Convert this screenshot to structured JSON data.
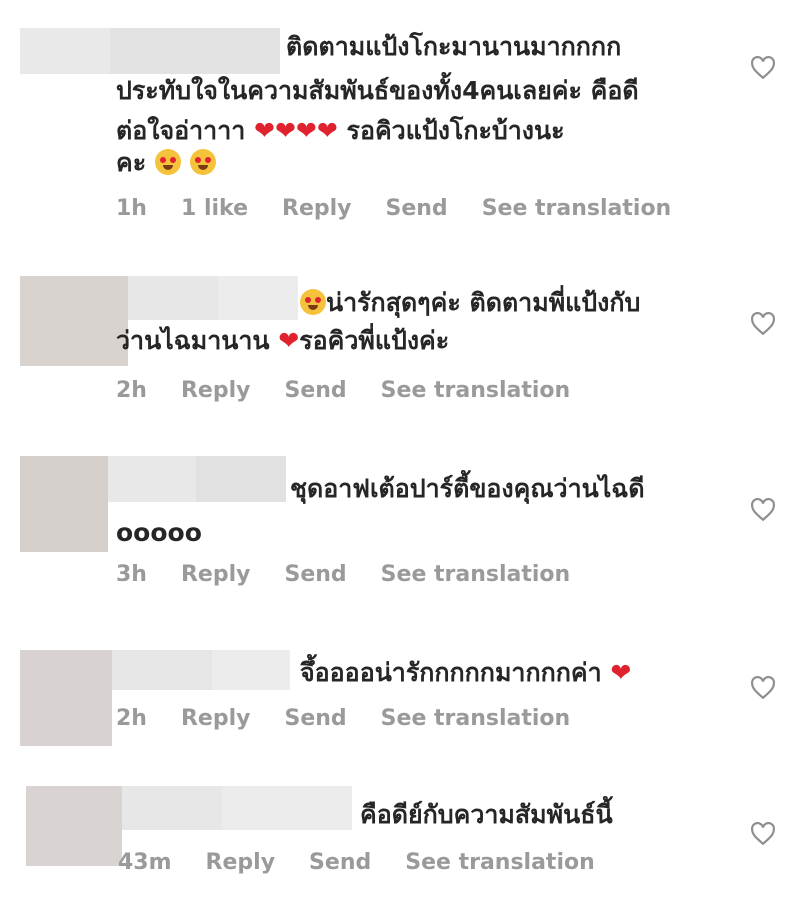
{
  "comments": [
    {
      "lines": [
        "ติดตามแป้งโกะมานานมากกกก",
        "ประทับใจในความสัมพันธ์ของทั้ง4คนเลยค่ะ คือดี",
        "ต่อใจอ่าาาา",
        "รอคิวแป้งโกะบ้างนะ",
        "คะ"
      ],
      "time": "1h",
      "likes": "1 like",
      "reply": "Reply",
      "send": "Send",
      "translate": "See translation"
    },
    {
      "lines": [
        "น่ารักสุดๆค่ะ ติดตามพี่แป้งกับ",
        "ว่านไฉมานาน",
        "รอคิวพี่แป้งค่ะ"
      ],
      "time": "2h",
      "reply": "Reply",
      "send": "Send",
      "translate": "See translation"
    },
    {
      "lines": [
        "ชุดอาฟเต้อปาร์ตี้ของคุณว่านไฉดี",
        "ooooo"
      ],
      "time": "3h",
      "reply": "Reply",
      "send": "Send",
      "translate": "See translation"
    },
    {
      "lines": [
        "จึ้ออออน่ารักกกกกมากกกค่า"
      ],
      "time": "2h",
      "reply": "Reply",
      "send": "Send",
      "translate": "See translation"
    },
    {
      "lines": [
        "คือดีย์กับความสัมพันธ์นี้"
      ],
      "time": "43m",
      "reply": "Reply",
      "send": "Send",
      "translate": "See translation"
    }
  ],
  "icons": {
    "like": "heart-outline-icon",
    "heart_emoji": "red-heart-emoji",
    "face_emoji": "heart-eyes-emoji"
  },
  "colors": {
    "text": "#262626",
    "meta": "#9a9a9a",
    "heart": "#e0222e",
    "censor": "#e6e6e6"
  }
}
